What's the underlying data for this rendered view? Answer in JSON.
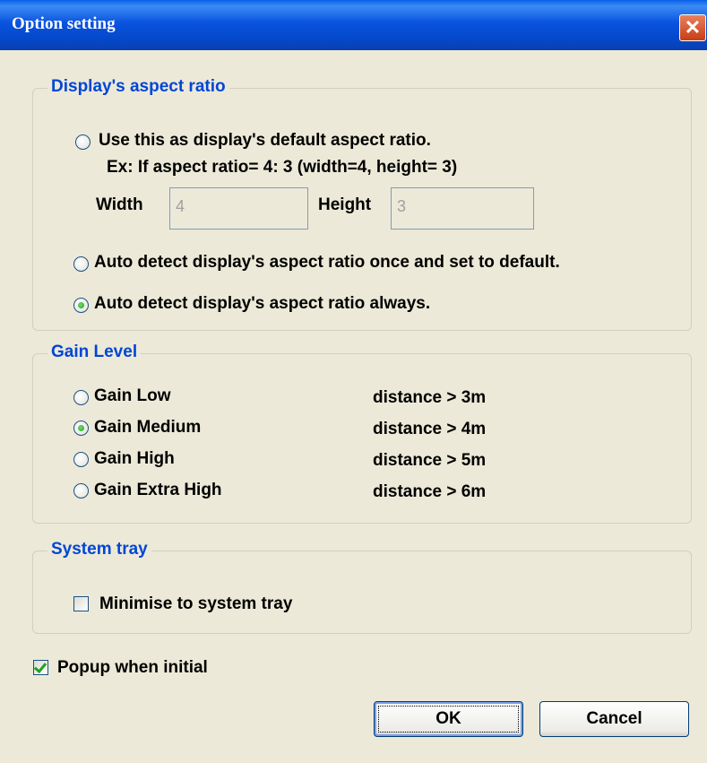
{
  "window": {
    "title": "Option setting",
    "close_symbol": "✕"
  },
  "aspect": {
    "legend": "Display's aspect ratio",
    "opt_default": "Use this as display's default aspect ratio.",
    "example": "Ex: If aspect ratio= 4: 3 (width=4, height= 3)",
    "width_label": "Width",
    "width_value": "4",
    "height_label": "Height",
    "height_value": "3",
    "opt_once": "Auto detect display's aspect ratio once and set to default.",
    "opt_always": "Auto detect display's aspect ratio always.",
    "selected": "always"
  },
  "gain": {
    "legend": "Gain Level",
    "levels": [
      {
        "label": "Gain Low",
        "distance": "distance > 3m",
        "selected": false
      },
      {
        "label": "Gain Medium",
        "distance": "distance > 4m",
        "selected": true
      },
      {
        "label": "Gain High",
        "distance": "distance > 5m",
        "selected": false
      },
      {
        "label": "Gain Extra High",
        "distance": "distance > 6m",
        "selected": false
      }
    ]
  },
  "tray": {
    "legend": "System tray",
    "minimise_label": "Minimise to system tray",
    "minimise_checked": false
  },
  "popup": {
    "label": "Popup when initial",
    "checked": true
  },
  "buttons": {
    "ok": "OK",
    "cancel": "Cancel"
  }
}
